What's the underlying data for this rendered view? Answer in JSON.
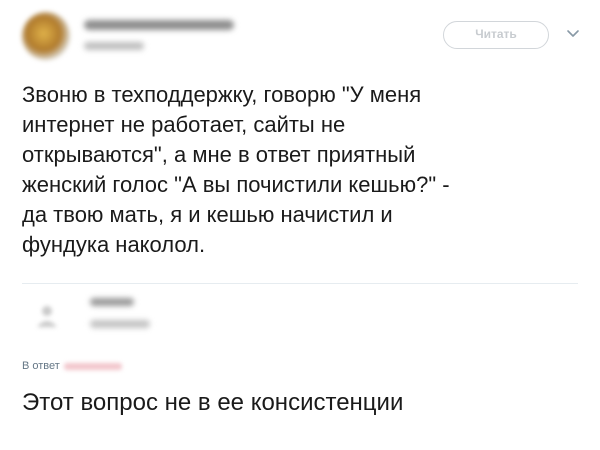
{
  "tweet": {
    "follow_label": "Читать",
    "text": "Звоню в техподдержку, говорю \"У меня\nинтернет не работает, сайты не\nоткрываются\", а мне в ответ приятный\nженский голос \"А вы почистили кешью?\" -\nда твою мать, я и кешью начистил и\nфундука наколол."
  },
  "reply": {
    "reply_to_label": "В ответ",
    "text": "Этот вопрос не в ее консистенции"
  },
  "colors": {
    "follow_border": "#d2d6da",
    "divider": "#e6ecf0"
  },
  "icons": {
    "menu": "chevron-down-icon"
  }
}
